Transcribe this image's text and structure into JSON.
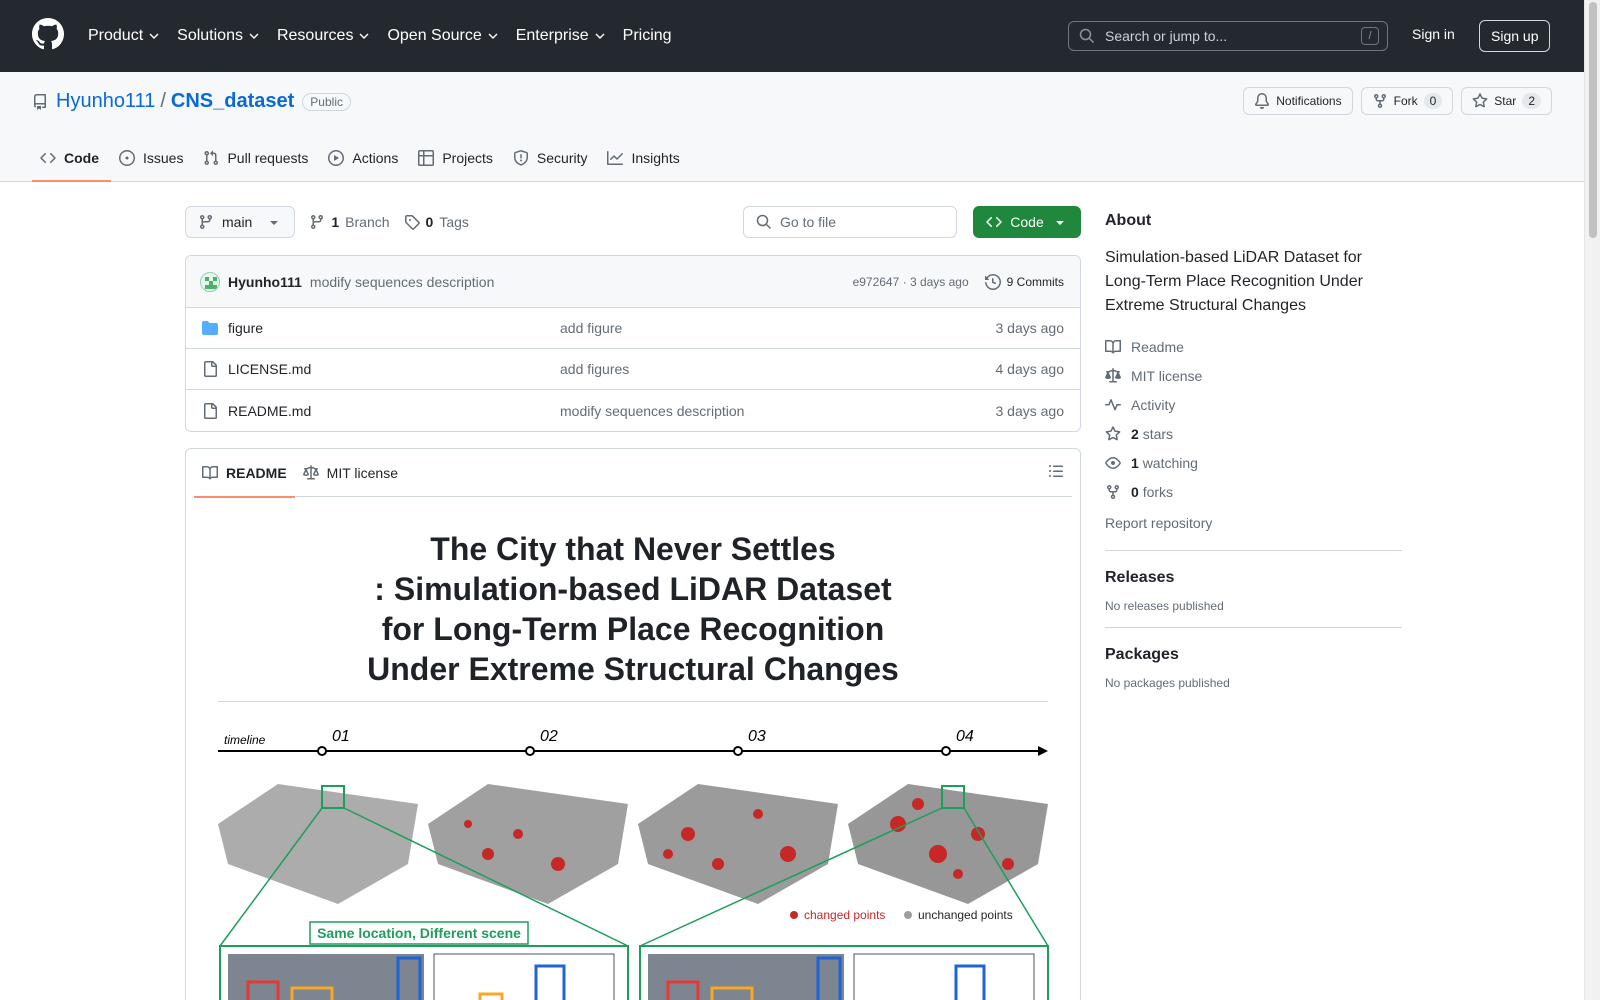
{
  "header": {
    "nav": [
      "Product",
      "Solutions",
      "Resources",
      "Open Source",
      "Enterprise",
      "Pricing"
    ],
    "search_placeholder": "Search or jump to...",
    "search_shortcut": "/",
    "signin": "Sign in",
    "signup": "Sign up"
  },
  "repo": {
    "owner": "Hyunho111",
    "separator": "/",
    "name": "CNS_dataset",
    "visibility": "Public",
    "notifications": "Notifications",
    "fork_label": "Fork",
    "fork_count": "0",
    "star_label": "Star",
    "star_count": "2",
    "tabs": [
      "Code",
      "Issues",
      "Pull requests",
      "Actions",
      "Projects",
      "Security",
      "Insights"
    ]
  },
  "toolbar": {
    "branch": "main",
    "branch_count": "1",
    "branch_label": "Branch",
    "tag_count": "0",
    "tag_label": "Tags",
    "goto_placeholder": "Go to file",
    "code_button": "Code"
  },
  "latest_commit": {
    "user": "Hyunho111",
    "message": "modify sequences description",
    "hash_time": "e972647 · 3 days ago",
    "commits": "9 Commits"
  },
  "files": [
    {
      "type": "folder",
      "name": "figure",
      "message": "add figure",
      "date": "3 days ago"
    },
    {
      "type": "file",
      "name": "LICENSE.md",
      "message": "add figures",
      "date": "4 days ago"
    },
    {
      "type": "file",
      "name": "README.md",
      "message": "modify sequences description",
      "date": "3 days ago"
    }
  ],
  "readme": {
    "tabs": [
      "README",
      "MIT license"
    ],
    "title_lines": [
      "The City that Never Settles",
      ": Simulation-based LiDAR Dataset",
      "for Long-Term Place Recognition",
      "Under Extreme Structural Changes"
    ],
    "figure": {
      "timeline_label": "timeline",
      "markers": [
        "01",
        "02",
        "03",
        "04"
      ],
      "legend_changed": "changed points",
      "legend_unchanged": "unchanged points",
      "callout": "Same location, Different scene"
    }
  },
  "about": {
    "heading": "About",
    "description": "Simulation-based LiDAR Dataset for Long-Term Place Recognition Under Extreme Structural Changes",
    "readme": "Readme",
    "license": "MIT license",
    "activity": "Activity",
    "stars_count": "2",
    "stars_label": "stars",
    "watching_count": "1",
    "watching_label": "watching",
    "forks_count": "0",
    "forks_label": "forks",
    "report": "Report repository"
  },
  "releases": {
    "heading": "Releases",
    "empty": "No releases published"
  },
  "packages": {
    "heading": "Packages",
    "empty": "No packages published"
  },
  "colors": {
    "header_bg": "#24292f",
    "link": "#0969da",
    "green": "#1f883d",
    "tab_underline": "#fd8c73"
  }
}
